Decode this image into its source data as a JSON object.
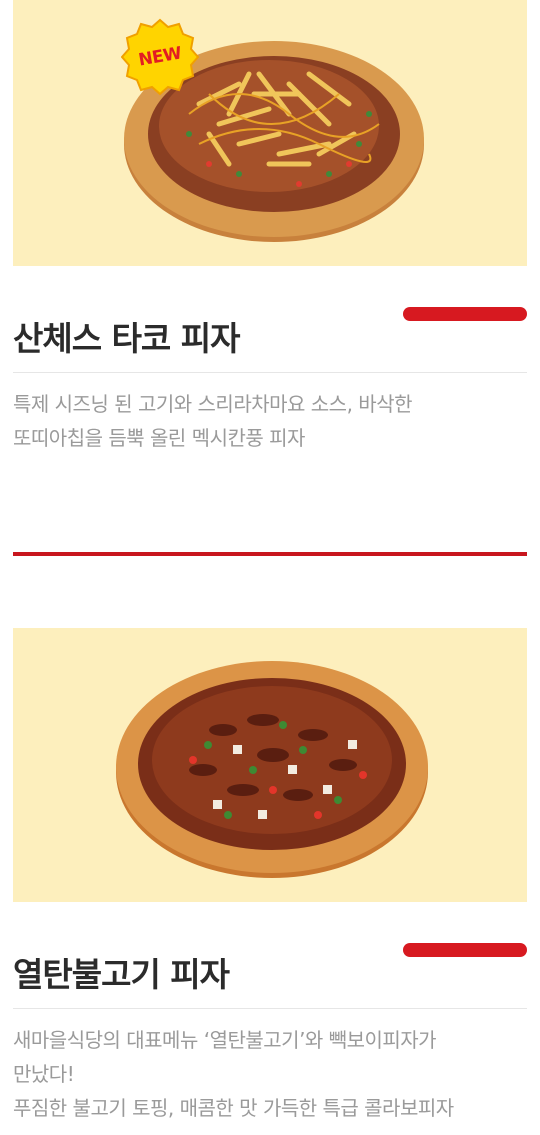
{
  "menu_items": [
    {
      "badge": "NEW",
      "title": "산체스 타코 피자",
      "description_lines": [
        "특제 시즈닝 된 고기와 스리라차마요 소스, 바삭한",
        "또띠아칩을 듬뿍 올린 멕시칸풍 피자"
      ]
    },
    {
      "title": "열탄불고기 피자",
      "description_lines": [
        "새마을식당의 대표메뉴 ‘열탄불고기’와 빽보이피자가",
        "만났다!",
        "푸짐한 불고기 토핑, 매콤한 맛 가득한 특급 콜라보피자"
      ]
    }
  ],
  "colors": {
    "image_background": "#fdefbd",
    "accent": "#d71920",
    "title": "#2b2b2b",
    "description": "#9a9a9a"
  }
}
